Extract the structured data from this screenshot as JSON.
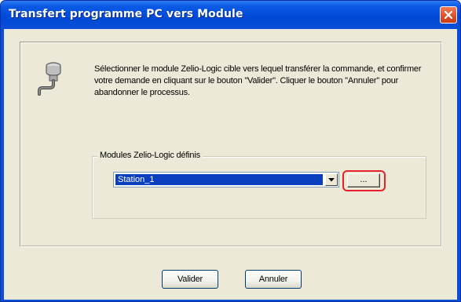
{
  "window": {
    "title": "Transfert programme PC vers Module",
    "close_icon": "close-icon"
  },
  "main": {
    "icon": "serial-cable-icon",
    "description": "Sélectionner le module Zelio-Logic cible vers lequel transférer la commande, et confirmer votre demande en cliquant sur le bouton \"Valider\". Cliquer le bouton \"Annuler\" pour abandonner le processus.",
    "group": {
      "legend": "Modules Zelio-Logic définis",
      "selected_value": "Station_1",
      "dropdown_icon": "chevron-down-icon",
      "browse_label": "..."
    }
  },
  "buttons": {
    "ok_label": "Valider",
    "cancel_label": "Annuler"
  },
  "colors": {
    "titlebar": "#0a4fd6",
    "client_bg": "#ece9d8",
    "selection": "#0a3fc0",
    "highlight_ring": "#e8202a"
  }
}
